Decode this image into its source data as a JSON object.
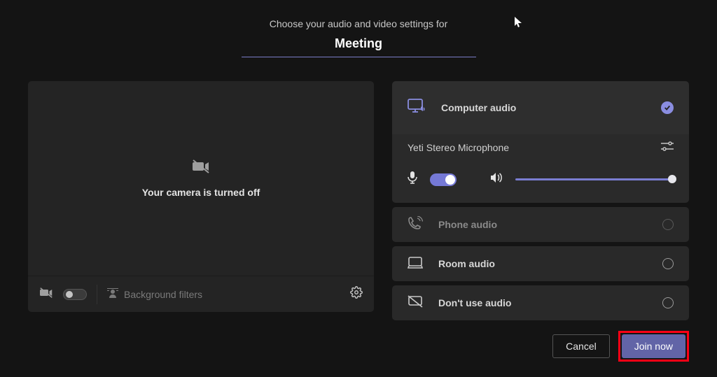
{
  "header": {
    "subtitle": "Choose your audio and video settings for",
    "title": "Meeting"
  },
  "video": {
    "camera_off_text": "Your camera is turned off",
    "background_filters_label": "Background filters"
  },
  "audio": {
    "selected_device": "Yeti Stereo Microphone",
    "options": {
      "computer": "Computer audio",
      "phone": "Phone audio",
      "room": "Room audio",
      "none": "Don't use audio"
    }
  },
  "footer": {
    "cancel": "Cancel",
    "join": "Join now"
  }
}
